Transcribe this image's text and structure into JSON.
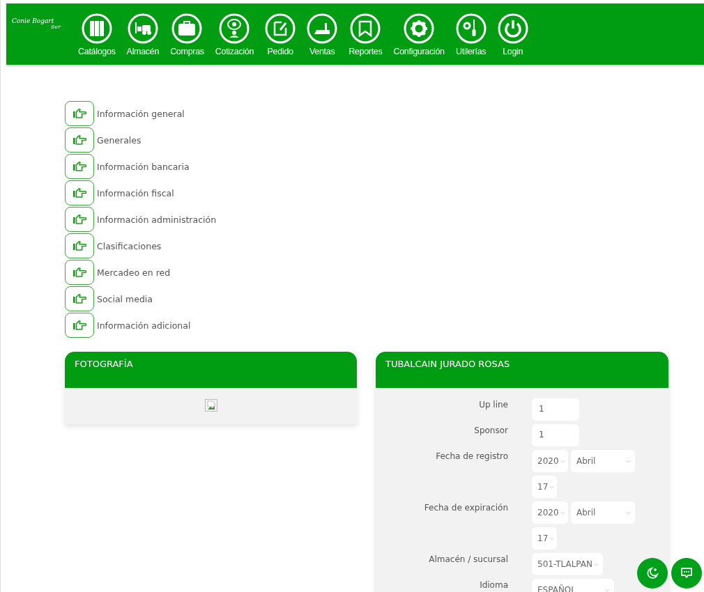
{
  "logo": {
    "name": "Conie Bogart",
    "tagline": "Ser"
  },
  "nav": [
    {
      "label": "Catálogos",
      "kind": "binders"
    },
    {
      "label": "Almacén",
      "kind": "forklift"
    },
    {
      "label": "Compras",
      "kind": "briefcase"
    },
    {
      "label": "Cotización",
      "kind": "bubble"
    },
    {
      "label": "Pedido",
      "kind": "edit"
    },
    {
      "label": "Ventas",
      "kind": "register"
    },
    {
      "label": "Reportes",
      "kind": "bookmark"
    },
    {
      "label": "Configuración",
      "kind": "gear"
    },
    {
      "label": "Utilerías",
      "kind": "tools"
    },
    {
      "label": "Login",
      "kind": "power"
    }
  ],
  "sections": [
    {
      "label": "Información general"
    },
    {
      "label": "Generales"
    },
    {
      "label": "Información bancaria"
    },
    {
      "label": "Información fiscal"
    },
    {
      "label": "Información administración"
    },
    {
      "label": "Clasificaciones"
    },
    {
      "label": "Mercadeo en red"
    },
    {
      "label": "Social media"
    },
    {
      "label": "Información adicional"
    }
  ],
  "photo_card": {
    "title": "FOTOGRAFÍA"
  },
  "profile_card": {
    "title": "TUBALCAIN JURADO ROSAS",
    "fields": [
      {
        "kind": "text",
        "label": "Up line",
        "value": "1"
      },
      {
        "kind": "text",
        "label": "Sponsor",
        "value": "1"
      },
      {
        "kind": "date",
        "label": "Fecha de registro",
        "year": "2020",
        "month": "Abril",
        "day": "17"
      },
      {
        "kind": "date",
        "label": "Fecha de expiración",
        "year": "2020",
        "month": "Abril",
        "day": "17"
      },
      {
        "kind": "select",
        "label": "Almacén / sucursal",
        "value": "501-TLALPAN"
      },
      {
        "kind": "select",
        "label": "Idioma",
        "value": "ESPAÑOL"
      }
    ]
  },
  "floating_buttons": [
    {
      "kind": "moon"
    },
    {
      "kind": "chat"
    }
  ]
}
